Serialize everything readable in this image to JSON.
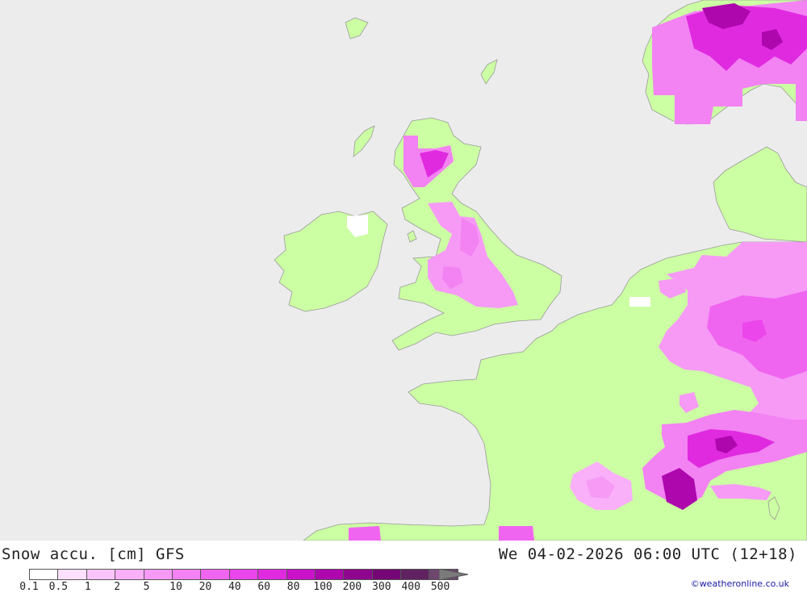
{
  "map": {
    "title": "Snow accu. [cm] GFS",
    "valid_time": "We 04-02-2026 06:00 UTC (12+18)",
    "credit": "©weatheronline.co.uk",
    "colors": {
      "sea": "#ececec",
      "land": "#ccfea3",
      "coast": "#9a9a9a"
    }
  },
  "legend": {
    "labels": [
      "0.1",
      "0.5",
      "1",
      "2",
      "5",
      "10",
      "20",
      "40",
      "60",
      "80",
      "100",
      "200",
      "300",
      "400",
      "500"
    ],
    "colors": [
      "#ffffff",
      "#fde0fd",
      "#fbc5fb",
      "#f9b0f9",
      "#f69af6",
      "#f382f3",
      "#f065f0",
      "#eb46eb",
      "#e02ae0",
      "#c912c9",
      "#ad07ad",
      "#8e068e",
      "#740774",
      "#602260",
      "#6e466e"
    ],
    "arrow_color": "#7a7a7a"
  }
}
